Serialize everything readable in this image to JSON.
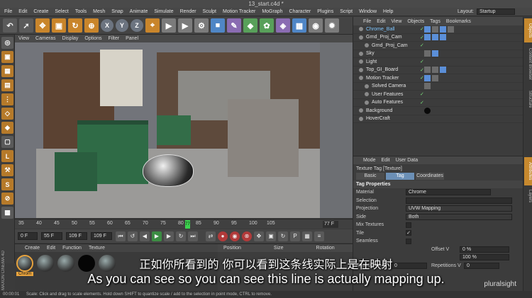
{
  "window": {
    "title": "13_start.c4d *"
  },
  "menubar": [
    "File",
    "Edit",
    "Create",
    "Select",
    "Tools",
    "Mesh",
    "Snap",
    "Animate",
    "Simulate",
    "Render",
    "Sculpt",
    "Motion Tracker",
    "MoGraph",
    "Character",
    "Plugins",
    "Script",
    "Window",
    "Help"
  ],
  "layout": {
    "label": "Layout:",
    "value": "Startup"
  },
  "toolbar": {
    "x": "X",
    "y": "Y",
    "z": "Z"
  },
  "viewport": {
    "menu": [
      "View",
      "Cameras",
      "Display",
      "Options",
      "Filter",
      "Panel"
    ]
  },
  "timeline": {
    "ticks": [
      "35",
      "40",
      "45",
      "50",
      "55",
      "60",
      "65",
      "70",
      "75",
      "80",
      "85",
      "90",
      "95",
      "100",
      "105"
    ],
    "current": "77",
    "end_field": "77 F"
  },
  "transport": {
    "start": "0 F",
    "range_start": "55 F",
    "range_end": "109 F",
    "end": "109 F"
  },
  "material_manager": {
    "menu": [
      "Create",
      "Edit",
      "Function",
      "Texture"
    ],
    "selected_label": "Chrom"
  },
  "coordinates": {
    "headers": [
      "Position",
      "Size",
      "Rotation"
    ]
  },
  "objects_panel": {
    "menu": [
      "File",
      "Edit",
      "View",
      "Objects",
      "Tags",
      "Bookmarks"
    ],
    "rows": [
      {
        "name": "Chrome_Ball",
        "indent": 0,
        "highlight": true
      },
      {
        "name": "Grnd_Proj_Cam",
        "indent": 0
      },
      {
        "name": "Grnd_Proj_Cam",
        "indent": 1
      },
      {
        "name": "Sky",
        "indent": 0
      },
      {
        "name": "Light",
        "indent": 0
      },
      {
        "name": "Top_GI_Board",
        "indent": 0
      },
      {
        "name": "Motion Tracker",
        "indent": 0
      },
      {
        "name": "Solved Camera",
        "indent": 1
      },
      {
        "name": "User Features",
        "indent": 1
      },
      {
        "name": "Auto Features",
        "indent": 1
      },
      {
        "name": "Background",
        "indent": 0
      },
      {
        "name": "HoverCraft",
        "indent": 0
      }
    ]
  },
  "attributes_panel": {
    "menu": [
      "Mode",
      "Edit",
      "User Data"
    ],
    "title": "Texture Tag [Texture]",
    "tabs": [
      "Basic",
      "Tag",
      "Coordinates"
    ],
    "active_tab": "Tag",
    "section": "Tag Properties",
    "material_label": "Material",
    "material_value": "Chrome",
    "selection_label": "Selection",
    "projection_label": "Projection",
    "projection_value": "UVW Mapping",
    "side_label": "Side",
    "side_value": "Both",
    "mix_label": "Mix Textures",
    "tile_label": "Tile",
    "tile_check": "✓",
    "seamless_label": "Seamless",
    "offset_v_label": "Offset V",
    "offset_v_value": "0 %",
    "length_v_value": "100 %",
    "rep_u_label": "Repetitions U",
    "rep_u_value": "0",
    "rep_v_label": "Repetitions V",
    "rep_v_value": "0"
  },
  "right_tabs": [
    "Objects",
    "Content Browser",
    "Structure",
    "Attributes",
    "Layers"
  ],
  "status": {
    "time": "00:00:01",
    "text": "Scale: Click and drag to scale elements. Hold down SHIFT to quantize scale / add to the selection in point mode, CTRL to remove."
  },
  "subtitles": {
    "chinese": "正如你所看到的 你可以看到这条线实际上是在映射",
    "english": "As you can see so you can see this line is actually mapping up."
  },
  "watermark": "pluralsight",
  "brand": "MAXON CINEMA 4D"
}
